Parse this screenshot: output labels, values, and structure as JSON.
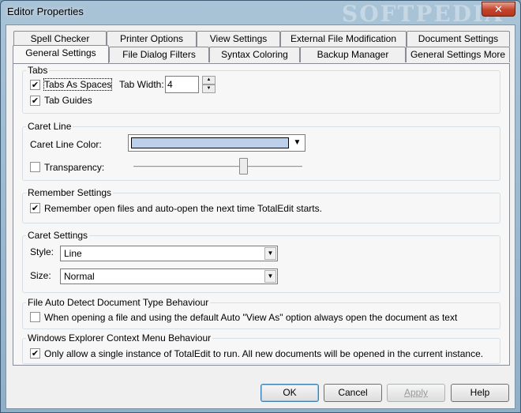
{
  "window": {
    "title": "Editor Properties",
    "watermark": "SOFTPEDIA",
    "close_glyph": "✕"
  },
  "tabs": {
    "row_top": [
      "Spell Checker",
      "Printer Options",
      "View Settings",
      "External File Modification",
      "Document Settings"
    ],
    "row_bottom": [
      "General Settings",
      "File Dialog Filters",
      "Syntax Coloring",
      "Backup Manager",
      "General Settings More"
    ],
    "active": "General Settings"
  },
  "groups": {
    "tabs": {
      "title": "Tabs",
      "tabs_as_spaces_label": "Tabs As Spaces",
      "tabs_as_spaces_checked": true,
      "tab_guides_label": "Tab Guides",
      "tab_guides_checked": true,
      "tab_width_label": "Tab Width:",
      "tab_width_value": "4"
    },
    "caret_line": {
      "title": "Caret Line",
      "color_label": "Caret Line Color:",
      "color_value": "#bcd0ec",
      "transparency_label": "Transparency:",
      "transparency_checked": false,
      "transparency_level": 0.66
    },
    "remember": {
      "title": "Remember Settings",
      "label": "Remember open files and auto-open the next time TotalEdit starts.",
      "checked": true
    },
    "caret_settings": {
      "title": "Caret Settings",
      "style_label": "Style:",
      "style_value": "Line",
      "size_label": "Size:",
      "size_value": "Normal"
    },
    "auto_detect": {
      "title": "File Auto Detect Document Type Behaviour",
      "label": "When opening a file and using the default Auto \"View As\" option always open the document as text",
      "checked": false
    },
    "context_menu": {
      "title": "Windows Explorer Context Menu Behaviour",
      "label": "Only allow a single instance of TotalEdit to run.  All new documents will be opened in the current instance.",
      "checked": true
    }
  },
  "buttons": {
    "ok": "OK",
    "cancel": "Cancel",
    "apply": "Apply",
    "help": "Help"
  },
  "icons": {
    "check": "✔",
    "dropdown": "▼",
    "spin_up": "▲",
    "spin_down": "▼",
    "close": "close-icon"
  }
}
